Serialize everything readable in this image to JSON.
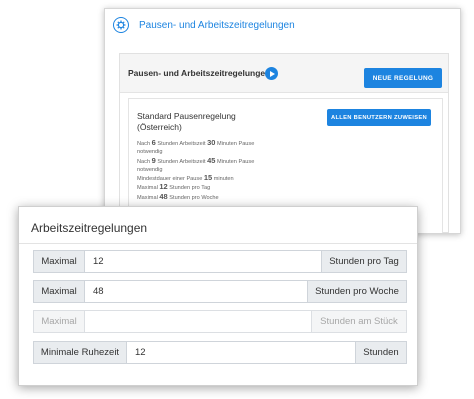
{
  "back_card": {
    "header_title": "Pausen- und Arbeitszeitregelungen",
    "panel_title": "Pausen- und Arbeitszeitregelungen",
    "new_button": "NEUE REGELUNG",
    "rule": {
      "title": "Standard Pausenregelung (Österreich)",
      "assign_button": "ALLEN BENUTZERN ZUWEISEN",
      "lines": [
        {
          "pre": "Nach ",
          "num": "6",
          "mid": " Stunden Arbeitszeit ",
          "num2": "30",
          "post": " Minuten Pause"
        },
        {
          "pre": "notwendig"
        },
        {
          "pre": "Nach ",
          "num": "9",
          "mid": " Stunden Arbeitszeit ",
          "num2": "45",
          "post": " Minuten Pause"
        },
        {
          "pre": "notwendig"
        },
        {
          "pre": "Mindestdauer einer Pause ",
          "num": "15",
          "mid": " minuten"
        },
        {
          "pre": "Maximal ",
          "num": "12",
          "mid": " Stunden pro Tag"
        },
        {
          "pre": "Maximal ",
          "num": "48",
          "mid": " Stunden pro Woche"
        }
      ]
    }
  },
  "front_card": {
    "title": "Arbeitszeitregelungen",
    "rows": [
      {
        "label": "Maximal",
        "value": "12",
        "unit": "Stunden pro Tag",
        "disabled": false
      },
      {
        "label": "Maximal",
        "value": "48",
        "unit": "Stunden pro Woche",
        "disabled": false
      },
      {
        "label": "Maximal",
        "value": "",
        "unit": "Stunden am Stück",
        "disabled": true
      },
      {
        "label": "Minimale Ruhezeit",
        "value": "12",
        "unit": "Stunden",
        "disabled": false
      }
    ]
  },
  "colors": {
    "accent": "#1d84e0"
  },
  "icons": {
    "header": "gear-icon",
    "panel": "play-icon"
  }
}
